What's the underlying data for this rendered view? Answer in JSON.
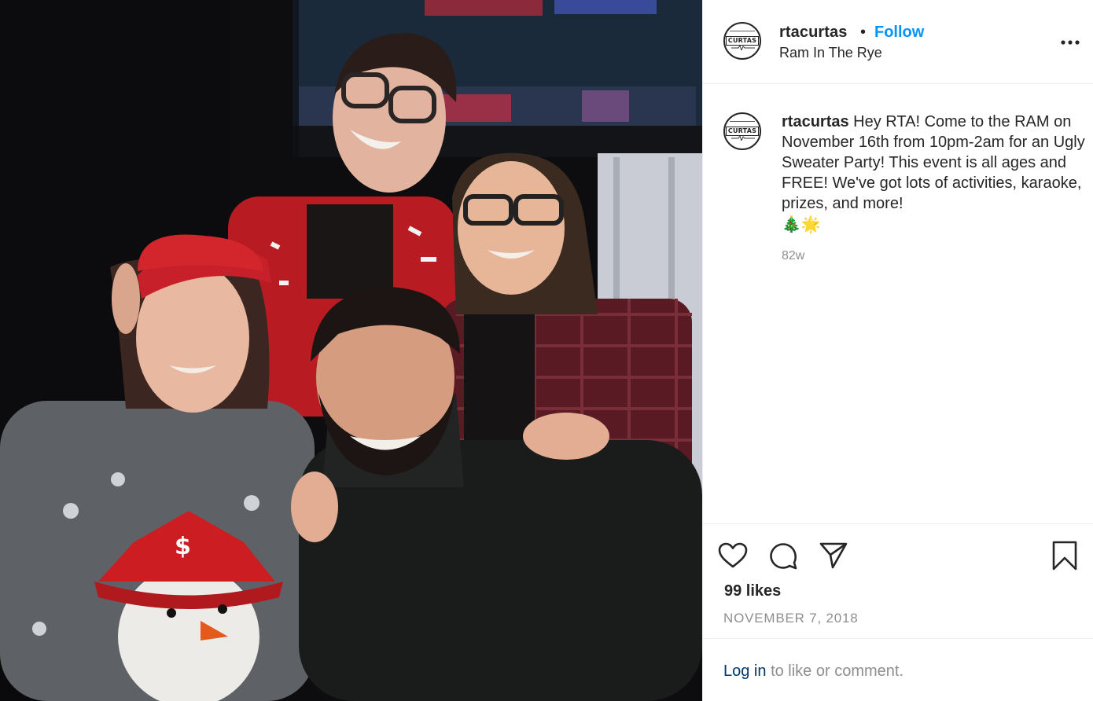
{
  "post": {
    "photo_alt": "",
    "author": {
      "username": "rtacurtas",
      "avatar_text": "CURTAS",
      "follow_label": "Follow",
      "separator": "•",
      "location": "Ram In The Rye"
    },
    "caption": {
      "username": "rtacurtas",
      "text": "Hey RTA! Come to the RAM on November 16th from 10pm-2am for an Ugly Sweater Party! This event is all ages and FREE! We've got lots of activities, karaoke, prizes, and more!",
      "emojis": "🎄🌟",
      "age": "82w"
    },
    "likes": "99 likes",
    "date": "NOVEMBER 7, 2018",
    "login": {
      "link": "Log in",
      "rest": "to like or comment."
    },
    "icons": {
      "more": "more-options-icon",
      "like": "heart-icon",
      "comment": "comment-icon",
      "share": "paper-plane-icon",
      "save": "bookmark-icon"
    },
    "colors": {
      "follow": "#0095f6",
      "login_link": "#00376b",
      "muted": "#8e8e8e",
      "text": "#262626",
      "divider": "#efefef"
    }
  }
}
